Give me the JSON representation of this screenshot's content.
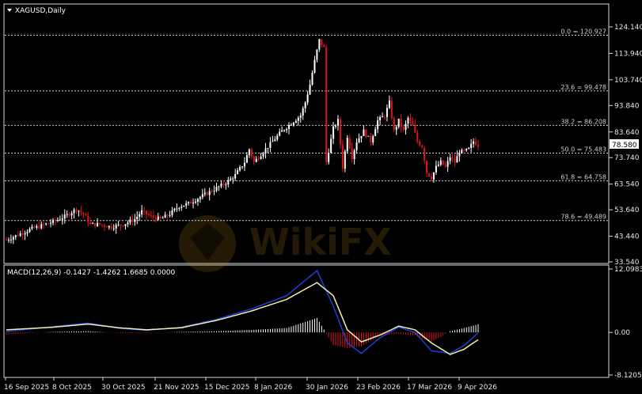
{
  "symbol": "XAGUSD,Daily",
  "macd_label": "MACD(12,26,9) -0.1427 -1.4262 1.6685 0.0000",
  "current_price": "78.580",
  "price_axis_labels": [
    "124.140",
    "113.940",
    "103.740",
    "93.840",
    "83.640",
    "73.740",
    "63.540",
    "53.640",
    "43.440",
    "33.540"
  ],
  "macd_axis_labels": [
    "12.0983",
    "0.00",
    "-8.1205"
  ],
  "date_labels": [
    "16 Sep 2025",
    "8 Oct 2025",
    "30 Oct 2025",
    "21 Nov 2025",
    "15 Dec 2025",
    "8 Jan 2026",
    "30 Jan 2026",
    "23 Feb 2026",
    "17 Mar 2026",
    "9 Apr 2026"
  ],
  "fib_levels": [
    {
      "label": "0.0 = 120.927",
      "value": 120.927
    },
    {
      "label": "23.6 = 99.478",
      "value": 99.478
    },
    {
      "label": "38.2 = 86.208",
      "value": 86.208
    },
    {
      "label": "50.0 = 75.483",
      "value": 75.483
    },
    {
      "label": "61.8 = 64.758",
      "value": 64.758
    },
    {
      "label": "78.6 = 49.489",
      "value": 49.489
    }
  ],
  "watermark": "WikiFX",
  "chart_data": {
    "type": "candlestick",
    "title": "XAGUSD,Daily",
    "ylim": [
      33.54,
      124.14
    ],
    "close_path": [
      [
        0,
        42
      ],
      [
        5,
        44
      ],
      [
        10,
        46
      ],
      [
        15,
        47.5
      ],
      [
        20,
        49
      ],
      [
        25,
        51
      ],
      [
        30,
        54
      ],
      [
        33,
        52
      ],
      [
        36,
        48
      ],
      [
        40,
        48
      ],
      [
        45,
        47
      ],
      [
        50,
        48
      ],
      [
        55,
        50
      ],
      [
        58,
        53
      ],
      [
        62,
        51
      ],
      [
        66,
        50
      ],
      [
        70,
        52
      ],
      [
        74,
        55
      ],
      [
        78,
        56
      ],
      [
        82,
        58
      ],
      [
        86,
        60
      ],
      [
        90,
        62
      ],
      [
        94,
        64
      ],
      [
        98,
        67
      ],
      [
        102,
        72
      ],
      [
        104,
        77
      ],
      [
        106,
        72
      ],
      [
        110,
        76
      ],
      [
        114,
        80
      ],
      [
        118,
        84
      ],
      [
        122,
        87
      ],
      [
        126,
        90
      ],
      [
        128,
        95
      ],
      [
        130,
        102
      ],
      [
        132,
        111
      ],
      [
        134,
        119
      ],
      [
        136,
        116
      ],
      [
        137,
        72
      ],
      [
        140,
        85
      ],
      [
        142,
        88
      ],
      [
        144,
        70
      ],
      [
        146,
        82
      ],
      [
        148,
        74
      ],
      [
        150,
        80
      ],
      [
        153,
        84
      ],
      [
        156,
        80
      ],
      [
        159,
        88
      ],
      [
        162,
        90
      ],
      [
        164,
        95
      ],
      [
        166,
        84
      ],
      [
        168,
        88
      ],
      [
        170,
        84
      ],
      [
        172,
        89
      ],
      [
        174,
        86
      ],
      [
        176,
        80
      ],
      [
        178,
        78
      ],
      [
        180,
        68
      ],
      [
        182,
        66
      ],
      [
        184,
        70
      ],
      [
        186,
        72
      ],
      [
        188,
        70
      ],
      [
        190,
        74
      ],
      [
        192,
        72
      ],
      [
        194,
        76
      ],
      [
        196,
        76
      ],
      [
        198,
        77
      ],
      [
        200,
        80
      ],
      [
        202,
        78.58
      ]
    ],
    "macd_line": [
      [
        0,
        0.2
      ],
      [
        20,
        1.1
      ],
      [
        35,
        1.8
      ],
      [
        48,
        0.8
      ],
      [
        60,
        0.4
      ],
      [
        75,
        1.0
      ],
      [
        90,
        2.5
      ],
      [
        105,
        4.5
      ],
      [
        120,
        7.0
      ],
      [
        133,
        11.8
      ],
      [
        140,
        5.0
      ],
      [
        146,
        -2.0
      ],
      [
        152,
        -4.0
      ],
      [
        160,
        -1.0
      ],
      [
        168,
        1.0
      ],
      [
        175,
        0.0
      ],
      [
        182,
        -3.5
      ],
      [
        190,
        -4.0
      ],
      [
        196,
        -2.5
      ],
      [
        202,
        -0.1
      ]
    ],
    "signal_line": [
      [
        0,
        0.5
      ],
      [
        20,
        1.0
      ],
      [
        35,
        1.6
      ],
      [
        48,
        0.9
      ],
      [
        60,
        0.5
      ],
      [
        75,
        0.9
      ],
      [
        90,
        2.3
      ],
      [
        105,
        4.1
      ],
      [
        120,
        6.3
      ],
      [
        133,
        9.5
      ],
      [
        140,
        7.0
      ],
      [
        146,
        0.5
      ],
      [
        152,
        -1.8
      ],
      [
        160,
        -0.5
      ],
      [
        168,
        1.2
      ],
      [
        175,
        0.5
      ],
      [
        182,
        -2.0
      ],
      [
        190,
        -4.2
      ],
      [
        196,
        -3.2
      ],
      [
        202,
        -1.4
      ]
    ],
    "macd_ylim": [
      -8.1205,
      12.0983
    ]
  }
}
